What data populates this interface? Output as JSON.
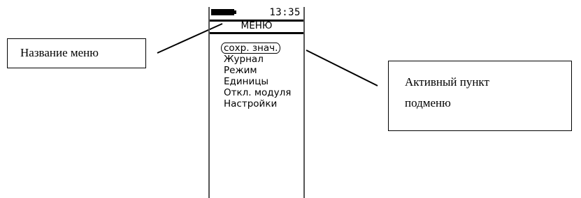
{
  "device": {
    "time": "13:35",
    "menu_title": "МЕНЮ",
    "menu_items": [
      {
        "label": "сохр. знач.",
        "active": true
      },
      {
        "label": "Журнал",
        "active": false
      },
      {
        "label": "Режим",
        "active": false
      },
      {
        "label": "Единицы",
        "active": false
      },
      {
        "label": "Откл. модуля",
        "active": false
      },
      {
        "label": "Настройки",
        "active": false
      }
    ]
  },
  "callouts": {
    "menu_name": "Название меню",
    "active_item_line1": "Активный пункт",
    "active_item_line2": "подменю"
  }
}
